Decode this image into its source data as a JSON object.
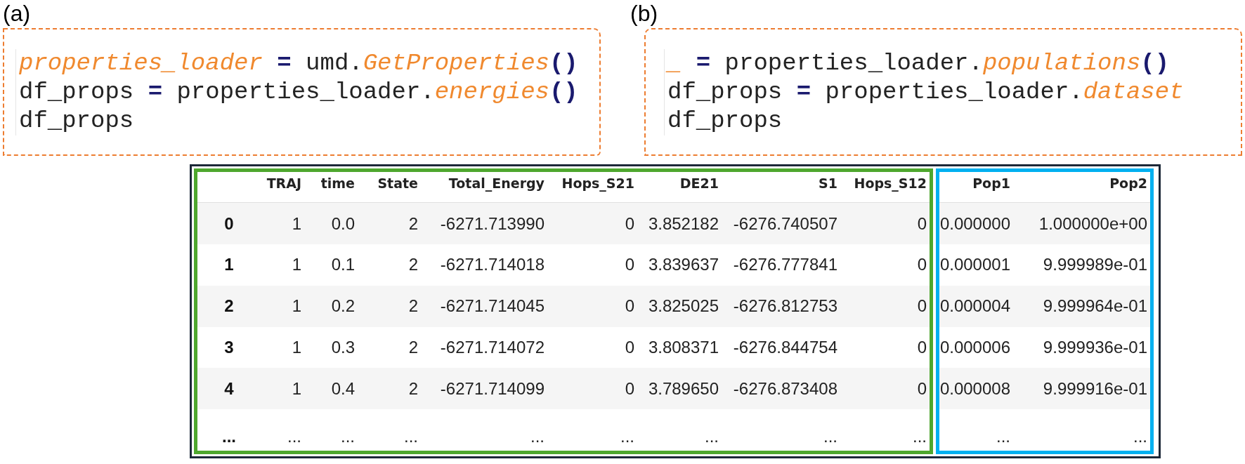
{
  "panels": [
    {
      "label": "(a)",
      "code": [
        [
          {
            "kind": "var",
            "text": "properties_loader"
          },
          {
            "kind": "op",
            "text": " ="
          },
          {
            "kind": "plain",
            "text": " umd."
          },
          {
            "kind": "var",
            "text": "GetProperties"
          },
          {
            "kind": "op",
            "text": "()"
          }
        ],
        [
          {
            "kind": "plain",
            "text": "df_props "
          },
          {
            "kind": "op",
            "text": "="
          },
          {
            "kind": "plain",
            "text": " properties_loader."
          },
          {
            "kind": "var",
            "text": "energies"
          },
          {
            "kind": "op",
            "text": "()"
          }
        ],
        [
          {
            "kind": "plain",
            "text": "df_props"
          }
        ]
      ]
    },
    {
      "label": "(b)",
      "code": [
        [
          {
            "kind": "var",
            "text": "_"
          },
          {
            "kind": "op",
            "text": " ="
          },
          {
            "kind": "plain",
            "text": " properties_loader."
          },
          {
            "kind": "var",
            "text": "populations"
          },
          {
            "kind": "op",
            "text": "()"
          }
        ],
        [
          {
            "kind": "plain",
            "text": "df_props "
          },
          {
            "kind": "op",
            "text": "="
          },
          {
            "kind": "plain",
            "text": " properties_loader."
          },
          {
            "kind": "var",
            "text": "dataset"
          }
        ],
        [
          {
            "kind": "plain",
            "text": "df_props"
          }
        ]
      ]
    }
  ],
  "table": {
    "column_groups": [
      {
        "color": "#4ea72e",
        "columns": [
          "TRAJ",
          "time",
          "State",
          "Total_Energy",
          "Hops_S21",
          "DE21",
          "S1",
          "Hops_S12"
        ]
      },
      {
        "color": "#00b0f0",
        "columns": [
          "Pop1",
          "Pop2"
        ]
      }
    ],
    "rows": [
      {
        "index": "0",
        "cells": [
          "1",
          "0.0",
          "2",
          "-6271.713990",
          "0",
          "3.852182",
          "-6276.740507",
          "0",
          "0.000000",
          "1.000000e+00"
        ]
      },
      {
        "index": "1",
        "cells": [
          "1",
          "0.1",
          "2",
          "-6271.714018",
          "0",
          "3.839637",
          "-6276.777841",
          "0",
          "0.000001",
          "9.999989e-01"
        ]
      },
      {
        "index": "2",
        "cells": [
          "1",
          "0.2",
          "2",
          "-6271.714045",
          "0",
          "3.825025",
          "-6276.812753",
          "0",
          "0.000004",
          "9.999964e-01"
        ]
      },
      {
        "index": "3",
        "cells": [
          "1",
          "0.3",
          "2",
          "-6271.714072",
          "0",
          "3.808371",
          "-6276.844754",
          "0",
          "0.000006",
          "9.999936e-01"
        ]
      },
      {
        "index": "4",
        "cells": [
          "1",
          "0.4",
          "2",
          "-6271.714099",
          "0",
          "3.789650",
          "-6276.873408",
          "0",
          "0.000008",
          "9.999916e-01"
        ]
      },
      {
        "index": "...",
        "cells": [
          "...",
          "...",
          "...",
          "...",
          "...",
          "...",
          "...",
          "...",
          "...",
          "..."
        ]
      }
    ]
  }
}
